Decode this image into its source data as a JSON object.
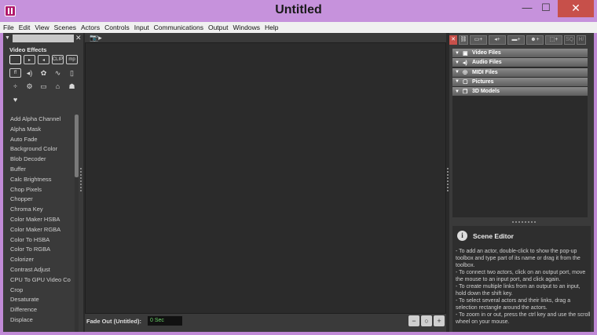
{
  "window": {
    "title": "Untitled",
    "min_glyph": "—",
    "max_glyph": "☐",
    "close_glyph": "✕"
  },
  "menu": [
    "File",
    "Edit",
    "View",
    "Scenes",
    "Actors",
    "Controls",
    "Input",
    "Communications",
    "Output",
    "Windows",
    "Help"
  ],
  "left_panel": {
    "search_placeholder": "",
    "clear_glyph": "✕",
    "collapse_glyph": "▼",
    "section_title": "Video Effects",
    "icon_rows": [
      [
        "rect-outline-icon",
        "image-in-icon",
        "image-out-icon",
        "clip-icon",
        "mp-icon"
      ],
      [
        "ff-icon",
        "speaker-icon",
        "palette-icon",
        "wave-icon",
        "mouse-icon"
      ],
      [
        "divide-icon",
        "gear-icon",
        "monitor-icon",
        "broadcast-icon",
        "people-icon"
      ],
      [
        "heart-icon"
      ]
    ],
    "effects": [
      "Add Alpha Channel",
      "Alpha Mask",
      "Auto Fade",
      "Background Color",
      "Blob Decoder",
      "Buffer",
      "Calc Brightness",
      "Chop Pixels",
      "Chopper",
      "Chroma Key",
      "Color Maker HSBA",
      "Color Maker RGBA",
      "Color To HSBA",
      "Color To RGBA",
      "Colorizer",
      "Contrast Adjust",
      "CPU To GPU Video Co",
      "Crop",
      "Desaturate",
      "Difference",
      "Displace"
    ]
  },
  "stage": {
    "camera_glyph": "📷▸",
    "fade_label": "Fade Out (Untitled):",
    "fade_value": "0 Sec",
    "zoom_buttons": [
      "zoom-out-icon",
      "zoom-fit-icon",
      "zoom-in-icon"
    ]
  },
  "right_panel": {
    "toolbar": [
      {
        "name": "close-media-button",
        "label": "✕",
        "style": "red"
      },
      {
        "name": "unlink-icon-button",
        "label": "⛓",
        "style": ""
      },
      {
        "name": "add-video-button",
        "label": "▭+",
        "style": ""
      },
      {
        "name": "add-audio-button",
        "label": "◂+",
        "style": ""
      },
      {
        "name": "add-screen-button",
        "label": "▬+",
        "style": ""
      },
      {
        "name": "add-midi-button",
        "label": "☻+",
        "style": ""
      },
      {
        "name": "add-3d-button",
        "label": "⬚+",
        "style": ""
      },
      {
        "name": "sq-button",
        "label": "SQ",
        "style": "dim"
      },
      {
        "name": "hz-button",
        "label": "H/",
        "style": "dim"
      }
    ],
    "media_groups": [
      {
        "label": "Video Files",
        "icon": "film-icon",
        "glyph": "▣"
      },
      {
        "label": "Audio Files",
        "icon": "speaker-icon",
        "glyph": "◂)"
      },
      {
        "label": "MIDI Files",
        "icon": "midi-icon",
        "glyph": "◎"
      },
      {
        "label": "Pictures",
        "icon": "picture-icon",
        "glyph": "▢"
      },
      {
        "label": "3D Models",
        "icon": "cube-icon",
        "glyph": "❒"
      }
    ],
    "scene_editor": {
      "title": "Scene Editor",
      "info_glyph": "i",
      "help_lines": [
        "- To add an actor, double-click to show the pop-up toolbox and type part of its name or drag it from the toolbox.",
        "- To connect two actors, click on an output port, move the mouse to an input port, and click again.",
        "- To create multiple links from an output to an input, hold down the shift key.",
        "- To select several actors and their links, drag a selection rectangle around the actors.",
        "- To zoom in or out, press the ctrl key and use the scroll wheel on your mouse."
      ]
    }
  }
}
